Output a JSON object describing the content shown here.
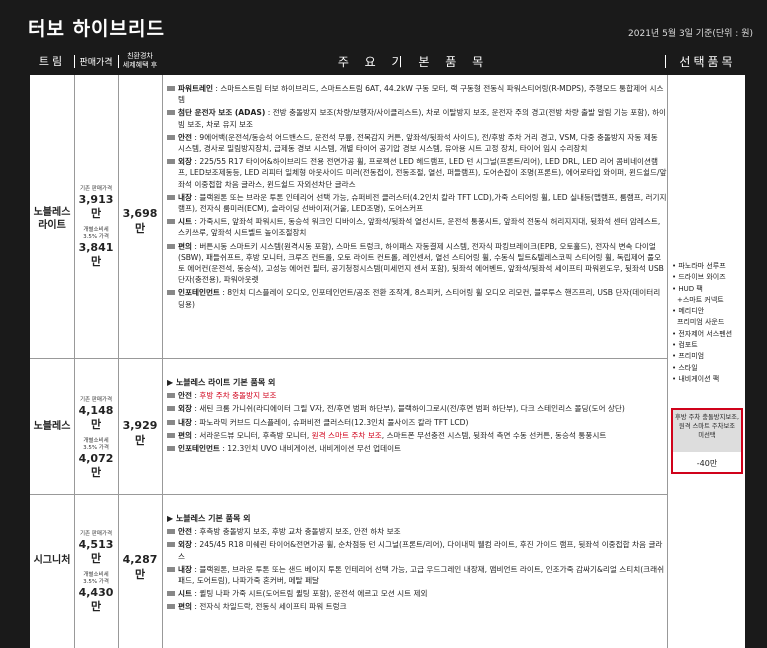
{
  "title": "터보 하이브리드",
  "date_note": "2021년 5월 3일 기준(단위 : 원)",
  "columns": {
    "trim": "트림",
    "price": "판매가격",
    "eco_line1": "친환경차",
    "eco_line2": "세제혜택 후",
    "main": "주 요 기 본 품 목",
    "options": "선택품목"
  },
  "trims": [
    {
      "name_line1": "노블레스",
      "name_line2": "라이트",
      "base_label": "기존 판매가격",
      "base_price": "3,913만",
      "ind_label_1": "개별소비세",
      "ind_label_2": "3.5% 가격",
      "ind_price": "3,841만",
      "eco_price": "3,698만",
      "features": [
        {
          "label": "파워트레인",
          "text": " : 스마트스트림 터보 하이브리드, 스마트스트림 6AT, 44.2kW 구동 모터, 랙 구동형 전동식 파워스티어링(R-MDPS), 주행모드 통합제어 시스템"
        },
        {
          "label": "첨단 운전자 보조 (ADAS)",
          "text": " : 전방 충돌방지 보조(차량/보행자/사이클리스트), 차로 이탈방지 보조, 운전자 주의 경고(전방 차량 출발 알림 기능 포함), 하이빔 보조, 차로 유지 보조"
        },
        {
          "label": "안전",
          "text": " : 9에어백(운전석/동승석 어드밴스드, 운전석 무릎, 전복감지 커튼, 앞좌석/뒷좌석 사이드), 전/후방 주차 거리 경고, VSM, 다중 충돌방지 자동 제동 시스템, 경사로 밀림방지장치, 급제동 경보 시스템, 개별 타이어 공기압 경보 시스템, 유아용 시트 고정 장치, 타이어 임시 수리장치"
        },
        {
          "label": "외장",
          "text": " : 225/55 R17 타이어&하이브리드 전용 전면가공 휠, 프로젝션 LED 헤드램프, LED 턴 시그널(프론트/리어), LED DRL, LED 리어 콤비네이션램프, LED보조제동등, LED 리피터 일체형 아웃사이드 미러(전동접이, 전동조절, 열선, 퍼들램프), 도어손잡이 조명(프론트), 에어로타입 와이퍼, 윈드쉴드/앞좌석 이중접합 차음 글라스, 윈드쉴드 자외선차단 글라스"
        },
        {
          "label": "내장",
          "text": " : 블랙원톤 또는 브라운 투톤 인테리어 선택 가능, 슈퍼비전 클러스터(4.2인치 칼라 TFT LCD),가죽 스티어링 휠, LED 실내등(맵램프, 룸램프, 러기지램프), 전자식 룸미러(ECM), 슬라이딩 선바이저(거울, LED조명), 도어스커프"
        },
        {
          "label": "시트",
          "text": " : 가죽시트, 앞좌석 파워시트, 동승석 워크인 디바이스, 앞좌석/뒷좌석 열선시트, 운전석 통풍시트, 앞좌석 전동식 허리지지대, 뒷좌석 센터 암레스트, 스키쓰루, 앞좌석 시트벨트 높이조절장치"
        },
        {
          "label": "편의",
          "text": " : 버튼시동 스마트키 시스템(원격시동 포함), 스마트 트렁크, 하이패스 자동결제 시스템, 전자식 파킹브레이크(EPB, 오토홀드), 전자식 변속 다이얼(SBW), 패들쉬프트, 후방 모니터, 크루즈 컨트롤, 오토 라이트 컨트롤, 레인센서, 열선 스티어링 휠, 수동식 틸트&텔레스코픽 스티어링 휠, 독립제어 풀오토 에어컨(운전석, 동승석), 고성능 에어컨 필터, 공기청정시스템(미세먼지 센서 포함), 뒷좌석 에어벤트, 앞좌석/뒷좌석 세이프티 파워윈도우, 뒷좌석 USB 단자(충전용), 파워아웃렛"
        },
        {
          "label": "인포테인먼트",
          "text": " : 8인치 디스플레이 오디오, 인포테인먼트/공조 전환 조작계, 8스피커, 스티어링 휠 오디오 리모컨, 블루투스 핸즈프리, USB 단자(데이터리딩용)"
        }
      ]
    },
    {
      "name": "노블레스",
      "base_label": "기존 판매가격",
      "base_price": "4,148만",
      "ind_label_1": "개별소비세",
      "ind_label_2": "3.5% 가격",
      "ind_price": "4,072만",
      "eco_price": "3,929만",
      "header": "▶ 노블레스 라이트 기본 품목 외",
      "features": [
        {
          "label": "안전",
          "text": " : ",
          "red": "후방 주차 충돌방지 보조",
          "text2": ""
        },
        {
          "label": "외장",
          "text": " : 새틴 크롬 가니쉬(라디에이터 그릴 V자, 전/후면 범퍼 하단부), 블랙하이그로시(전/후면 범퍼 하단부), 다크 스테인리스 몰딩(도어 상단)",
          "red": "",
          "text2": ""
        },
        {
          "label": "내장",
          "text": " : 파노라믹 커브드 디스플레이, 슈퍼비전 클러스터(12.3인치 풀사이즈 칼라 TFT LCD)",
          "red": "",
          "text2": ""
        },
        {
          "label": "편의",
          "text": " : 서라운드뷰 모니터, 후측방 모니터, ",
          "red": "원격 스마트 주차 보조",
          "text2": ", 스마트폰 무선충전 시스템, 뒷좌석 측면 수동 선커튼, 동승석 통풍시트"
        },
        {
          "label": "인포테인먼트",
          "text": " : 12.3인치 UVO 내비게이션, 내비게이션 무선 업데이트",
          "red": "",
          "text2": ""
        }
      ]
    },
    {
      "name": "시그니처",
      "base_label": "기존 판매가격",
      "base_price": "4,513만",
      "ind_label_1": "개별소비세",
      "ind_label_2": "3.5% 가격",
      "ind_price": "4,430만",
      "eco_price": "4,287만",
      "header": "▶ 노블레스 기본 품목 외",
      "features": [
        {
          "label": "안전",
          "text": " : 후측방 충돌방지 보조, 후방 교차 충돌방지 보조, 안전 하차 보조"
        },
        {
          "label": "외장",
          "text": " : 245/45 R18 미쉐린 타이어&전면가공 휠, 순차점등 턴 시그널(프론트/리어), 다이내믹 웰컴 라이트, 후진 가이드 램프, 뒷좌석 이중접합 차음 글라스"
        },
        {
          "label": "내장",
          "text": " : 블랙원톤, 브라운 투톤 또는 샌드 베이지 투톤 인테리어 선택 가능, 고급 우드그레인 내장재, 앰비언트 라이트, 인조가죽 감싸기&리얼 스티치(크래쉬패드, 도어트림), 나파가죽 혼커버, 메탈 페달"
        },
        {
          "label": "시트",
          "text": " : 퀼팅 나파 가죽 시트(도어트림 퀼팅 포함), 운전석 에르고 모션 시트 제외"
        },
        {
          "label": "편의",
          "text": " : 전자식 차일드락, 전동식 세이프티 파워 트렁크"
        }
      ]
    }
  ],
  "options": [
    "• 파노라마 선루프",
    "• 드라이브 와이즈",
    "• HUD 팩",
    "+스마트 커넥트",
    "• 메리디안",
    "프리미엄 사운드",
    "• 전자제어 서스펜션",
    "• 컴포트",
    "• 프리미엄",
    "• 스타일",
    "• 내비게이션 팩"
  ],
  "option_box": {
    "line1": "후방 주차 충돌방지보조,",
    "line2": "원격 스마트 주차보조",
    "line3": "미선택",
    "value": "-40만"
  }
}
